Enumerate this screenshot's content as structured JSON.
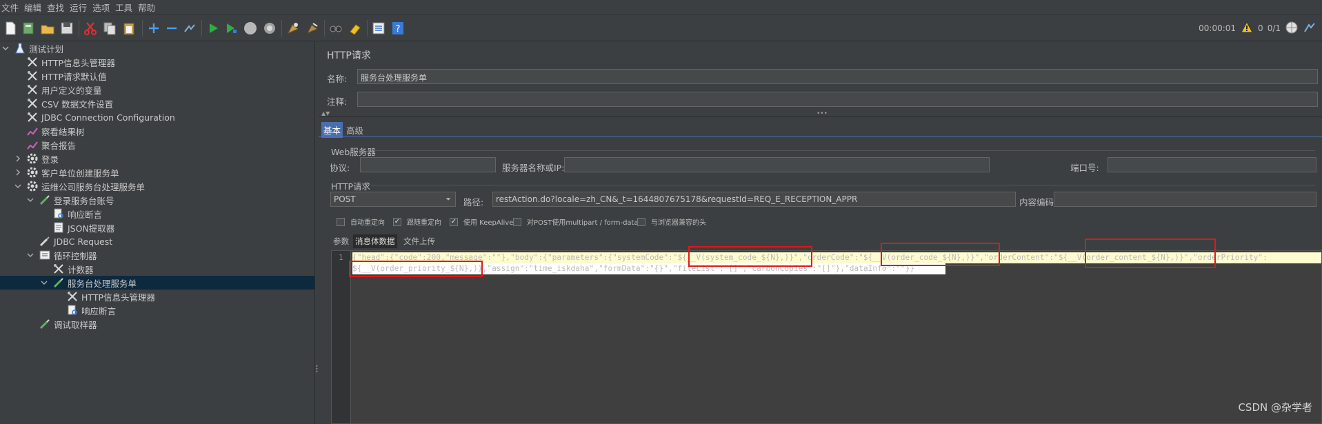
{
  "menubar": {
    "items": [
      "文件",
      "编辑",
      "查找",
      "运行",
      "选项",
      "工具",
      "帮助"
    ]
  },
  "toolbar": {
    "timer": "00:00:01",
    "warnings": "0",
    "threads": "0/1",
    "icons": [
      "new-icon",
      "templates-icon",
      "open-icon",
      "save-icon",
      "cut-icon",
      "copy-icon",
      "paste-icon",
      "expand-icon",
      "collapse-icon",
      "toggle-icon",
      "start-icon",
      "start-no-pause-icon",
      "stop-icon",
      "shutdown-icon",
      "clear-icon",
      "clear-all-icon",
      "search-icon",
      "reset-search-icon",
      "function-helper-icon",
      "help-icon"
    ]
  },
  "tree": {
    "nodes": [
      {
        "label": "测试计划",
        "icon": "flask-icon",
        "level": 0,
        "expanded": true
      },
      {
        "label": "HTTP信息头管理器",
        "icon": "wrench-icon",
        "level": 1
      },
      {
        "label": "HTTP请求默认值",
        "icon": "wrench-icon",
        "level": 1
      },
      {
        "label": "用户定义的变量",
        "icon": "wrench-icon",
        "level": 1
      },
      {
        "label": "CSV 数据文件设置",
        "icon": "wrench-icon",
        "level": 1
      },
      {
        "label": "JDBC Connection Configuration",
        "icon": "wrench-icon",
        "level": 1
      },
      {
        "label": "察看结果树",
        "icon": "chart-icon",
        "level": 1
      },
      {
        "label": "聚合报告",
        "icon": "chart-icon",
        "level": 1
      },
      {
        "label": "登录",
        "icon": "gear-icon",
        "level": 1,
        "expanded": false
      },
      {
        "label": "客户单位创建服务单",
        "icon": "gear-icon",
        "level": 1,
        "expanded": false
      },
      {
        "label": "运维公司服务台处理服务单",
        "icon": "gear-icon",
        "level": 1,
        "expanded": true
      },
      {
        "label": "登录服务台账号",
        "icon": "pipette-icon",
        "level": 2,
        "expanded": true
      },
      {
        "label": "响应断言",
        "icon": "doc-search-icon",
        "level": 3
      },
      {
        "label": "JSON提取器",
        "icon": "doc-icon",
        "level": 3
      },
      {
        "label": "JDBC Request",
        "icon": "pipette-icon",
        "level": 2
      },
      {
        "label": "循环控制器",
        "icon": "loop-icon",
        "level": 2,
        "expanded": true
      },
      {
        "label": "计数器",
        "icon": "wrench-icon",
        "level": 3
      },
      {
        "label": "服务台处理服务单",
        "icon": "pipette-icon",
        "level": 3,
        "expanded": true,
        "selected": true
      },
      {
        "label": "HTTP信息头管理器",
        "icon": "wrench-icon",
        "level": 4
      },
      {
        "label": "响应断言",
        "icon": "doc-search-icon",
        "level": 4
      },
      {
        "label": "调试取样器",
        "icon": "pipette-icon",
        "level": 2
      }
    ]
  },
  "panel": {
    "title": "HTTP请求",
    "name_label": "名称:",
    "name_value": "服务台处理服务单",
    "comment_label": "注释:",
    "comment_value": "",
    "tabs": [
      "基本",
      "高级"
    ],
    "web_server_group": "Web服务器",
    "protocol_label": "协议:",
    "protocol_value": "",
    "server_label": "服务器名称或IP:",
    "server_value": "",
    "port_label": "端口号:",
    "port_value": "",
    "http_request_group": "HTTP请求",
    "method_value": "POST",
    "path_label": "路径:",
    "path_value": "restAction.do?locale=zh_CN&_t=1644807675178&requestId=REQ_E_RECEPTION_APPR",
    "encoding_label": "内容编码:",
    "encoding_value": "",
    "checkboxes": [
      {
        "label": "自动重定向",
        "checked": false
      },
      {
        "label": "跟随重定向",
        "checked": true
      },
      {
        "label": "使用 KeepAlive",
        "checked": true
      },
      {
        "label": "对POST使用multipart / form-data",
        "checked": false
      },
      {
        "label": "与浏览器兼容的头",
        "checked": false
      }
    ],
    "body_tabs": [
      "参数",
      "消息体数据",
      "文件上传"
    ]
  },
  "editor": {
    "line_number": "1",
    "line1": "{\"head\":{\"code\":200,\"message\":\"\"},\"body\":{\"parameters\":{\"systemCode\":\"${__V(system_code_${N},)}\",\"orderCode\":\"${__V(order_code_${N},)}\",\"orderContent\":\"${__V(order_content_${N},)}\",\"orderPriority\":",
    "line2": "${__V(order_priority_${N},)},\"assign\":\"time_iskdaha\",\"formData\":\"{}\",\"fileList\":\"[]\",\"carbonCopies\":\"[]\"},\"dataInfo\":\"\"}}"
  },
  "watermark": "CSDN @杂学者"
}
